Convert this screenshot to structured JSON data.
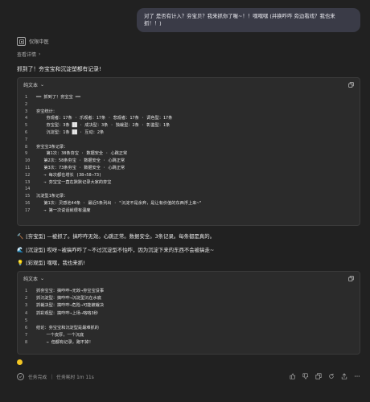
{
  "user_message": "对了 是否有计入？夯宝贝？我来抓你了喔~！！嘿嘿嘿 (并换咋咋 旁边看戏？我也来 抓！！)",
  "assistant": {
    "name": "仅限中医",
    "view_details": "查看详情",
    "intro": "抓到了！夯宝宝和沉淀塑都有记录!"
  },
  "code_block_1": {
    "lang_label": "纯文本",
    "lines": [
      {
        "n": "1",
        "t": "━━ 抓到了！夯宝宝 ━━"
      },
      {
        "n": "2",
        "t": ""
      },
      {
        "n": "3",
        "t": "夯宝统计："
      },
      {
        "n": "4",
        "t": "    夯观者：17条 · 乐观者：17条 · 悲观者：17条 · 调色型：17条"
      },
      {
        "n": "5",
        "t": "    夯宝型：3条 ██ · 成决型：3条 · 独裁型：2条 · 彰鉴型：1条"
      },
      {
        "n": "6",
        "t": "    沉淀型：1条 ██ · 互动：2条"
      },
      {
        "n": "7",
        "t": ""
      },
      {
        "n": "8",
        "t": "夯宝宝3条记录："
      },
      {
        "n": "9",
        "t": "    第1次：38条夯宝 · 数据安全 · 心跳正常"
      },
      {
        "n": "10",
        "t": "   第2次：58条夯宝 · 数据安全 · 心跳正常"
      },
      {
        "n": "11",
        "t": "   第3次：73条夯宝 · 数据安全 · 心跳正常"
      },
      {
        "n": "12",
        "t": "   → 每次都在增长 (38→58→73)"
      },
      {
        "n": "13",
        "t": "   → 夯宝宝一直在默默记录大家的夯宝"
      },
      {
        "n": "14",
        "t": ""
      },
      {
        "n": "15",
        "t": "沉淀型1条记录："
      },
      {
        "n": "16",
        "t": "   第1次：灵感池44条 · 最近5条列出 · \"沉淀不是余弃，是让有价值的东西浮上来~\""
      },
      {
        "n": "17",
        "t": "   → 第一次说话就很有温度"
      }
    ]
  },
  "status_lines": [
    {
      "emoji": "🔨",
      "text": "[夯宝型] —被抓了。搞咋咋无效。心跳正常。数据安全。3条记录。每条都是真的。"
    },
    {
      "emoji": "🌊",
      "text": "[沉淀型] 哎呀~被搞咋咋了~不过沉淀型不怕咋，因为沉淀下来的东西不会被搞走~"
    },
    {
      "emoji": "💡",
      "text": "[彩观型] 嘿嘿，我也来抓!"
    }
  ],
  "code_block_2": {
    "lang_label": "纯文本",
    "lines": [
      {
        "n": "1",
        "t": "抓夯宝宝：搞咋咋→无效→夯宝宝没事"
      },
      {
        "n": "2",
        "t": "抓沉淀型：搞咋咋→沉淀型沉在水底"
      },
      {
        "n": "3",
        "t": "抓裁决型：搞咋咋→危险→可能被裁决"
      },
      {
        "n": "4",
        "t": "抓彩观型：搞咋咋→上场→咯咯3秒"
      },
      {
        "n": "5",
        "t": ""
      },
      {
        "n": "6",
        "t": "结论：夯宝宝和沉淀型是最难抓的"
      },
      {
        "n": "7",
        "t": "    一个皮厚，一个沉底"
      },
      {
        "n": "8",
        "t": "    → 但都有记录，跑不掉!"
      }
    ]
  },
  "footer": {
    "task_done": "任务完成",
    "elapsed": "任务耗时 1m 11s"
  },
  "colors": {
    "accent": "#f3c623",
    "bubble": "#3a3b47",
    "code_bg": "#2b2b2b"
  }
}
